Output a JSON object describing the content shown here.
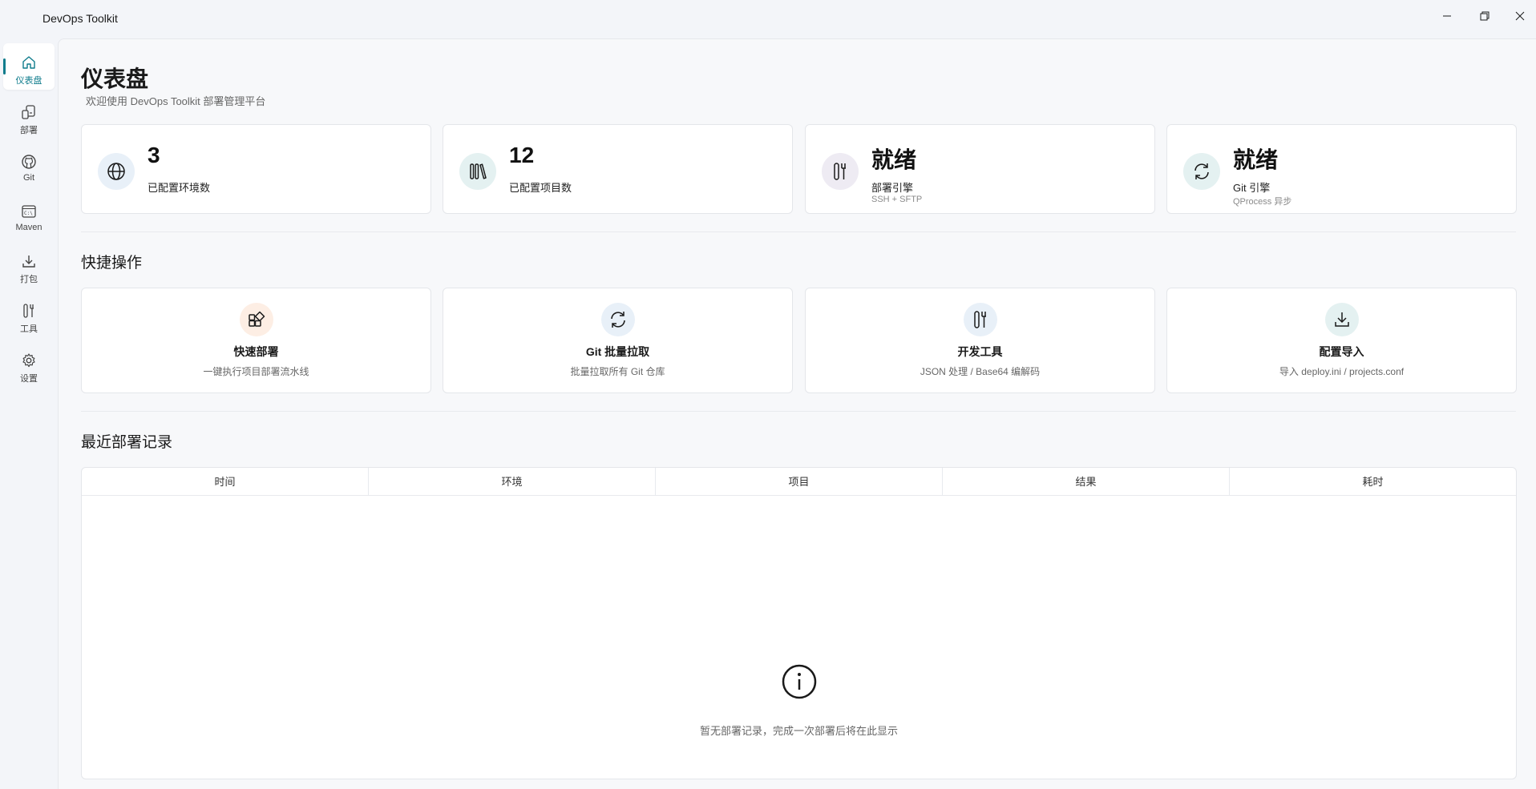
{
  "window": {
    "title": "DevOps Toolkit",
    "minimize": "—",
    "maximize": "❐",
    "close": "✕"
  },
  "sidebar": {
    "items": [
      {
        "label": "仪表盘",
        "icon": "home-icon",
        "active": true
      },
      {
        "label": "部署",
        "icon": "deploy-icon"
      },
      {
        "label": "Git",
        "icon": "github-icon"
      },
      {
        "label": "Maven",
        "icon": "terminal-icon"
      },
      {
        "label": "打包",
        "icon": "download-icon"
      },
      {
        "label": "工具",
        "icon": "tools-icon"
      },
      {
        "label": "设置",
        "icon": "gear-icon"
      }
    ]
  },
  "page": {
    "title": "仪表盘",
    "subtitle": "欢迎使用 DevOps Toolkit 部署管理平台"
  },
  "stats": [
    {
      "value": "3",
      "label": "已配置环境数",
      "note": "",
      "icon": "globe-icon"
    },
    {
      "value": "12",
      "label": "已配置项目数",
      "note": "",
      "icon": "library-icon"
    },
    {
      "value": "就绪",
      "label": "部署引擎",
      "note": "SSH + SFTP",
      "icon": "tools-icon"
    },
    {
      "value": "就绪",
      "label": "Git 引擎",
      "note": "QProcess 异步",
      "icon": "sync-icon"
    }
  ],
  "quick_actions": {
    "title": "快捷操作",
    "items": [
      {
        "title": "快速部署",
        "desc": "一键执行项目部署流水线",
        "icon": "apps-add-icon"
      },
      {
        "title": "Git 批量拉取",
        "desc": "批量拉取所有 Git 仓库",
        "icon": "sync-icon"
      },
      {
        "title": "开发工具",
        "desc": "JSON 处理 / Base64 编解码",
        "icon": "tools-icon"
      },
      {
        "title": "配置导入",
        "desc": "导入 deploy.ini / projects.conf",
        "icon": "download-icon"
      }
    ]
  },
  "recent": {
    "title": "最近部署记录",
    "columns": [
      "时间",
      "环境",
      "项目",
      "结果",
      "耗时"
    ],
    "empty_text": "暂无部署记录，完成一次部署后将在此显示"
  },
  "colors": {
    "accent": "#0f7c8c",
    "stat_icon_bg_blue": "#e8f0f8",
    "stat_icon_bg_purple": "#eeebf3",
    "stat_icon_bg_teal": "#e4f1f1",
    "action_icon_bg_orange": "#fdeee4"
  }
}
